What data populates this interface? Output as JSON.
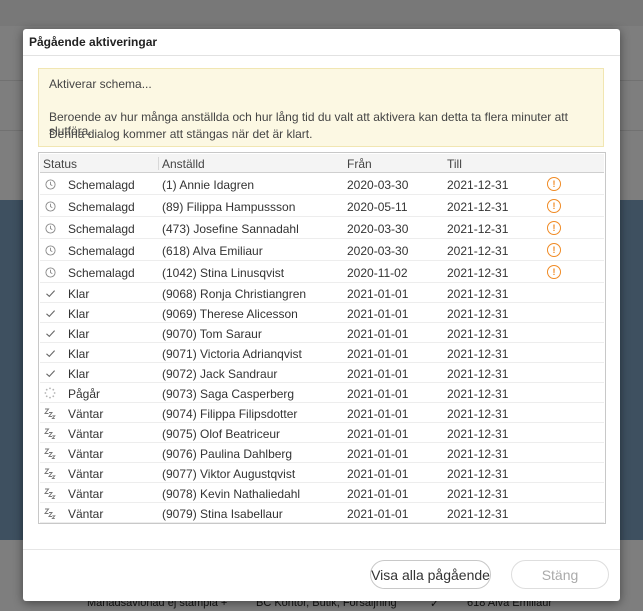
{
  "dialog": {
    "title": "Pågående aktiveringar",
    "info_line1": "Aktiverar schema...",
    "info_line2": "Beroende av hur många anställda och hur lång tid du valt att aktivera kan detta ta flera minuter att slutföra.",
    "info_line3": "Denna dialog kommer att stängas när det är klart."
  },
  "table": {
    "headers": {
      "status": "Status",
      "employee": "Anställd",
      "from": "Från",
      "to": "Till"
    },
    "rows": [
      {
        "icon": "clock-icon",
        "status": "Schemalagd",
        "employee": "(1) Annie Idagren",
        "from": "2020-03-30",
        "to": "2021-12-31",
        "warning": true
      },
      {
        "icon": "clock-icon",
        "status": "Schemalagd",
        "employee": "(89) Filippa Hampussson",
        "from": "2020-05-11",
        "to": "2021-12-31",
        "warning": true
      },
      {
        "icon": "clock-icon",
        "status": "Schemalagd",
        "employee": "(473) Josefine Sannadahl",
        "from": "2020-03-30",
        "to": "2021-12-31",
        "warning": true
      },
      {
        "icon": "clock-icon",
        "status": "Schemalagd",
        "employee": "(618) Alva Emiliaur",
        "from": "2020-03-30",
        "to": "2021-12-31",
        "warning": true
      },
      {
        "icon": "clock-icon",
        "status": "Schemalagd",
        "employee": "(1042) Stina Linusqvist",
        "from": "2020-11-02",
        "to": "2021-12-31",
        "warning": true
      },
      {
        "icon": "check-icon",
        "status": "Klar",
        "employee": "(9068) Ronja Christiangren",
        "from": "2021-01-01",
        "to": "2021-12-31",
        "warning": false
      },
      {
        "icon": "check-icon",
        "status": "Klar",
        "employee": "(9069) Therese Alicesson",
        "from": "2021-01-01",
        "to": "2021-12-31",
        "warning": false
      },
      {
        "icon": "check-icon",
        "status": "Klar",
        "employee": "(9070) Tom Saraur",
        "from": "2021-01-01",
        "to": "2021-12-31",
        "warning": false
      },
      {
        "icon": "check-icon",
        "status": "Klar",
        "employee": "(9071) Victoria Adrianqvist",
        "from": "2021-01-01",
        "to": "2021-12-31",
        "warning": false
      },
      {
        "icon": "check-icon",
        "status": "Klar",
        "employee": "(9072) Jack Sandraur",
        "from": "2021-01-01",
        "to": "2021-12-31",
        "warning": false
      },
      {
        "icon": "spinner-icon",
        "status": "Pågår",
        "employee": "(9073) Saga Casperberg",
        "from": "2021-01-01",
        "to": "2021-12-31",
        "warning": false
      },
      {
        "icon": "waiting-icon",
        "status": "Väntar",
        "employee": "(9074) Filippa Filipsdotter",
        "from": "2021-01-01",
        "to": "2021-12-31",
        "warning": false
      },
      {
        "icon": "waiting-icon",
        "status": "Väntar",
        "employee": "(9075) Olof Beatriceur",
        "from": "2021-01-01",
        "to": "2021-12-31",
        "warning": false
      },
      {
        "icon": "waiting-icon",
        "status": "Väntar",
        "employee": "(9076) Paulina Dahlberg",
        "from": "2021-01-01",
        "to": "2021-12-31",
        "warning": false
      },
      {
        "icon": "waiting-icon",
        "status": "Väntar",
        "employee": "(9077) Viktor Augustqvist",
        "from": "2021-01-01",
        "to": "2021-12-31",
        "warning": false
      },
      {
        "icon": "waiting-icon",
        "status": "Väntar",
        "employee": "(9078) Kevin Nathaliedahl",
        "from": "2021-01-01",
        "to": "2021-12-31",
        "warning": false
      },
      {
        "icon": "waiting-icon",
        "status": "Väntar",
        "employee": "(9079) Stina Isabellaur",
        "from": "2021-01-01",
        "to": "2021-12-31",
        "warning": false
      }
    ]
  },
  "buttons": {
    "show_all": "Visa alla pågående",
    "close": "Stäng"
  },
  "background": {
    "row_text_1": "Månadsavlönad ej stämpla +",
    "row_text_2": "BC Kontor, Butik, Försäljning",
    "row_text_3": "618 Alva Emiliaur"
  },
  "colors": {
    "warning": "#f08a24",
    "info_bg": "#fcf8e3"
  }
}
